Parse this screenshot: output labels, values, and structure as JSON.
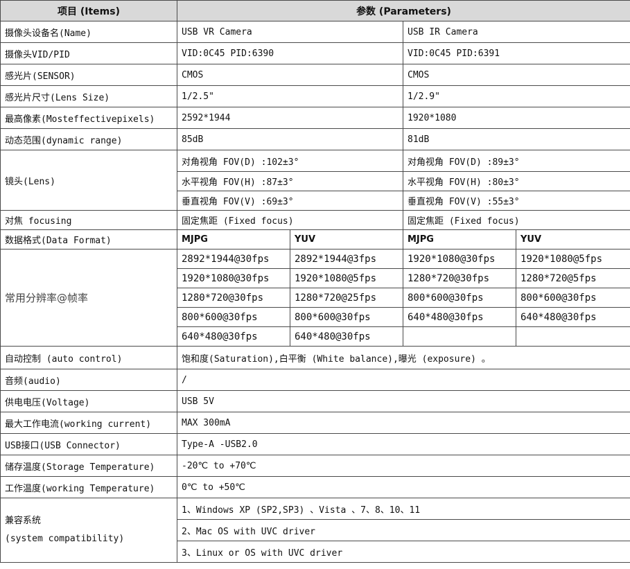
{
  "header": {
    "items": "项目 (Items)",
    "parameters": "参数  (Parameters)"
  },
  "rows": {
    "name": {
      "label": "摄像头设备名(Name)",
      "vr": "USB VR Camera",
      "ir": "USB IR Camera"
    },
    "vidpid": {
      "label": "摄像头VID/PID",
      "vr": "VID:0C45  PID:6390",
      "ir": "VID:0C45  PID:6391"
    },
    "sensor": {
      "label": "感光片(SENSOR)",
      "vr": "CMOS",
      "ir": "CMOS"
    },
    "lens_size": {
      "label": "感光片尺寸(Lens Size)",
      "vr": "1/2.5\"",
      "ir": "1/2.9\""
    },
    "pixels": {
      "label": "最高像素(Mosteffectivepixels)",
      "vr": "2592*1944",
      "ir": "1920*1080"
    },
    "dynamic": {
      "label": "动态范围(dynamic  range)",
      "vr": "85dB",
      "ir": "81dB"
    },
    "lens": {
      "label": "镜头(Lens)",
      "vr": [
        "对角视角 FOV(D) :102±3°",
        "水平视角 FOV(H) :87±3°",
        "垂直视角 FOV(V) :69±3°"
      ],
      "ir": [
        "对角视角 FOV(D) :89±3°",
        "水平视角 FOV(H) :80±3°",
        "垂直视角 FOV(V) :55±3°"
      ]
    },
    "focusing": {
      "label": "对焦 focusing",
      "vr": "固定焦距 (Fixed focus)",
      "ir": "固定焦距 (Fixed focus)"
    },
    "format": {
      "label": "数据格式(Data Format)",
      "vr_mjpg": "MJPG",
      "vr_yuv": "YUV",
      "ir_mjpg": "MJPG",
      "ir_yuv": "YUV"
    },
    "resolution": {
      "label": "常用分辨率@帧率",
      "vr_mjpg": [
        "2892*1944@30fps",
        "1920*1080@30fps",
        "1280*720@30fps",
        "800*600@30fps",
        "640*480@30fps"
      ],
      "vr_yuv": [
        "2892*1944@3fps",
        "1920*1080@5fps",
        "1280*720@25fps",
        "800*600@30fps",
        "640*480@30fps"
      ],
      "ir_mjpg": [
        "1920*1080@30fps",
        "1280*720@30fps",
        "800*600@30fps",
        "640*480@30fps"
      ],
      "ir_yuv": [
        "1920*1080@5fps",
        "1280*720@5fps",
        "800*600@30fps",
        "640*480@30fps"
      ]
    },
    "auto_control": {
      "label": "自动控制 (auto control)",
      "value": "饱和度(Saturation),白平衡 (White balance),曝光 (exposure) 。"
    },
    "audio": {
      "label": "音频(audio)",
      "value": "/"
    },
    "voltage": {
      "label": "供电电压(Voltage)",
      "value": "USB 5V"
    },
    "current": {
      "label": "最大工作电流(working current)",
      "value": "MAX 300mA"
    },
    "usb": {
      "label": "USB接口(USB Connector)",
      "value": "Type-A -USB2.0"
    },
    "storage_temp": {
      "label": "储存温度(Storage Temperature)",
      "value": "-20℃ to +70℃"
    },
    "working_temp": {
      "label": "工作温度(working Temperature)",
      "value": "0℃ to +50℃"
    },
    "compat": {
      "label_cn": "兼容系统",
      "label_en": "(system compatibility)",
      "values": [
        "1、Windows XP (SP2,SP3) 、Vista 、7、8、10、11",
        "2、Mac OS with UVC driver",
        "3、Linux or OS with UVC driver"
      ]
    }
  }
}
